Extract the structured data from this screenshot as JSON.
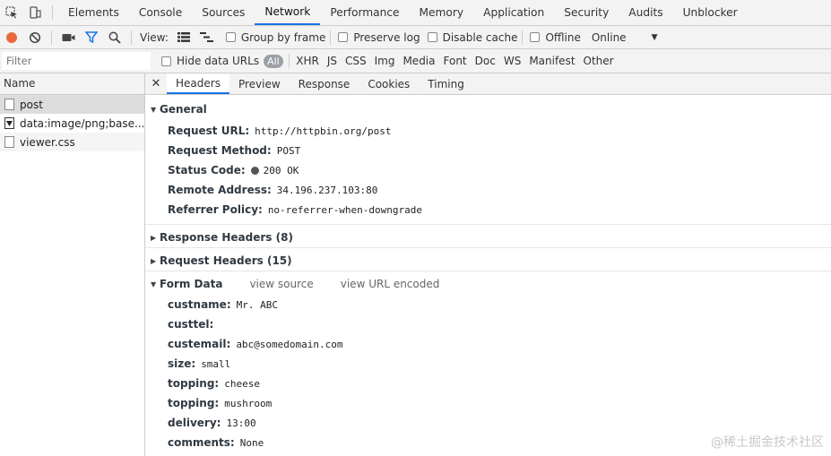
{
  "tabs": [
    "Elements",
    "Console",
    "Sources",
    "Network",
    "Performance",
    "Memory",
    "Application",
    "Security",
    "Audits",
    "Unblocker"
  ],
  "active_tab": "Network",
  "toolbar": {
    "view_label": "View:",
    "group_by_frame": "Group by frame",
    "preserve_log": "Preserve log",
    "disable_cache": "Disable cache",
    "offline": "Offline",
    "throttle": "Online",
    "record_color": "#e8693f",
    "filter_color": "#1a73e8"
  },
  "filterbar": {
    "placeholder": "Filter",
    "hide_data_urls": "Hide data URLs",
    "types": [
      "All",
      "XHR",
      "JS",
      "CSS",
      "Img",
      "Media",
      "Font",
      "Doc",
      "WS",
      "Manifest",
      "Other"
    ]
  },
  "requests": {
    "header": "Name",
    "items": [
      "post",
      "data:image/png;base...",
      "viewer.css"
    ]
  },
  "detail_tabs": [
    "Headers",
    "Preview",
    "Response",
    "Cookies",
    "Timing"
  ],
  "general": {
    "title": "General",
    "request_url_label": "Request URL:",
    "request_url": "http://httpbin.org/post",
    "request_method_label": "Request Method:",
    "request_method": "POST",
    "status_code_label": "Status Code:",
    "status_code": "200 OK",
    "remote_address_label": "Remote Address:",
    "remote_address": "34.196.237.103:80",
    "referrer_policy_label": "Referrer Policy:",
    "referrer_policy": "no-referrer-when-downgrade"
  },
  "response_headers": "Response Headers (8)",
  "request_headers": "Request Headers (15)",
  "form_data": {
    "title": "Form Data",
    "view_source": "view source",
    "view_url_encoded": "view URL encoded",
    "fields": [
      {
        "key": "custname:",
        "value": "Mr. ABC"
      },
      {
        "key": "custtel:",
        "value": ""
      },
      {
        "key": "custemail:",
        "value": "abc@somedomain.com"
      },
      {
        "key": "size:",
        "value": "small"
      },
      {
        "key": "topping:",
        "value": "cheese"
      },
      {
        "key": "topping:",
        "value": "mushroom"
      },
      {
        "key": "delivery:",
        "value": "13:00"
      },
      {
        "key": "comments:",
        "value": "None"
      }
    ]
  },
  "watermark": "@稀土掘金技术社区"
}
